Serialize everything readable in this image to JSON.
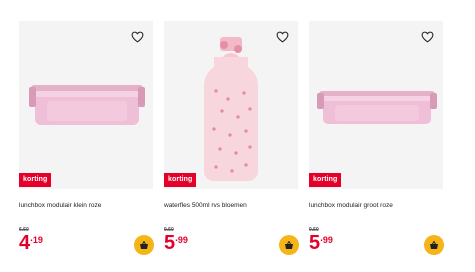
{
  "products": [
    {
      "title": "lunchbox modulair klein roze",
      "badge": "korting",
      "old_price": "6.50",
      "price_euros": "4",
      "price_sep": ".",
      "price_cents": "19",
      "image": "pink-lunchbox-small"
    },
    {
      "title": "waterfles 500ml rvs bloemen",
      "badge": "korting",
      "old_price": "9.50",
      "price_euros": "5",
      "price_sep": ".",
      "price_cents": "99",
      "image": "pink-flower-water-bottle"
    },
    {
      "title": "lunchbox modulair groot roze",
      "badge": "korting",
      "old_price": "9.50",
      "price_euros": "5",
      "price_sep": ".",
      "price_cents": "99",
      "image": "pink-lunchbox-large"
    }
  ],
  "icons": {
    "favorite": "heart-outline-icon",
    "cart": "shopping-basket-icon"
  },
  "colors": {
    "badge": "#e4002b",
    "price": "#e4002b",
    "cart_button": "#f5b519",
    "image_bg": "#f4f4f4"
  }
}
